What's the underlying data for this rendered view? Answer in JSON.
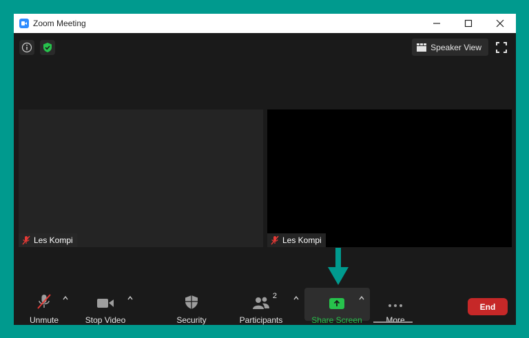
{
  "window": {
    "title": "Zoom Meeting",
    "controls": [
      "minimize-icon",
      "maximize-icon",
      "close-icon"
    ]
  },
  "topbar": {
    "speaker_view_label": "Speaker View",
    "icons": [
      "info-icon",
      "security-shield-icon",
      "grid-icon",
      "fullscreen-icon"
    ],
    "shield_color": "#27c24c"
  },
  "tiles": [
    {
      "participant_name": "Les Kompi",
      "muted": true,
      "background": "#242424"
    },
    {
      "participant_name": "Les Kompi",
      "muted": true,
      "background": "#000000"
    }
  ],
  "toolbar": {
    "unmute_label": "Unmute",
    "stop_video_label": "Stop Video",
    "security_label": "Security",
    "participants_label": "Participants",
    "participants_count": "2",
    "share_screen_label": "Share Screen",
    "more_label": "More",
    "end_label": "End"
  },
  "colors": {
    "accent_teal": "#009a8e",
    "share_green": "#27c24c",
    "end_red": "#c62828",
    "muted_red": "#e53935"
  }
}
